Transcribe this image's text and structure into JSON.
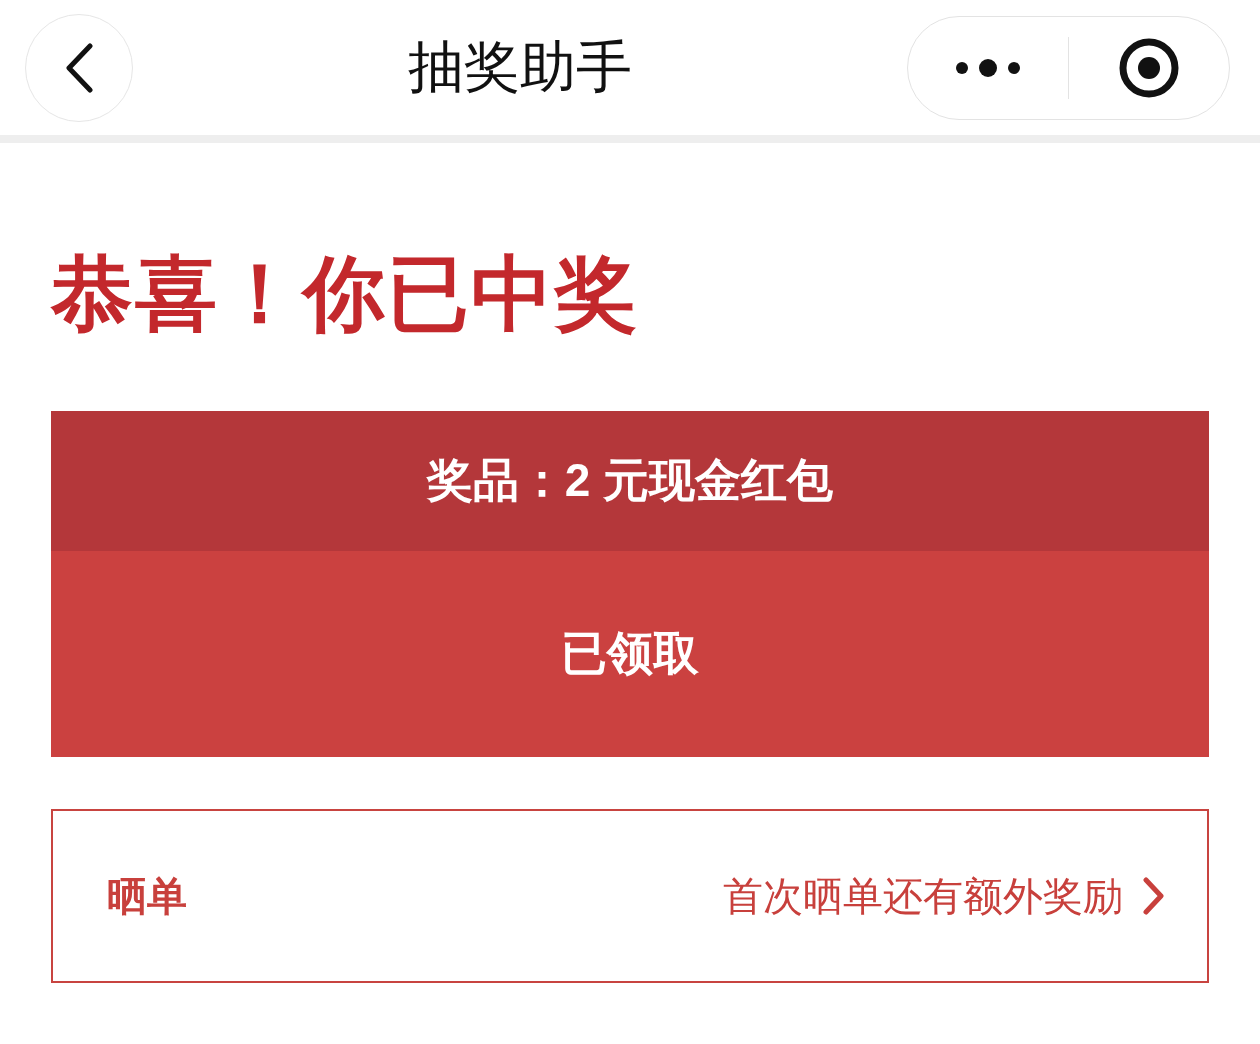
{
  "nav": {
    "title": "抽奖助手"
  },
  "headline": "恭喜！你已中奖",
  "prize": {
    "label": "奖品：2 元现金红包",
    "status": "已领取"
  },
  "share": {
    "label": "晒单",
    "hint": "首次晒单还有额外奖励"
  }
}
